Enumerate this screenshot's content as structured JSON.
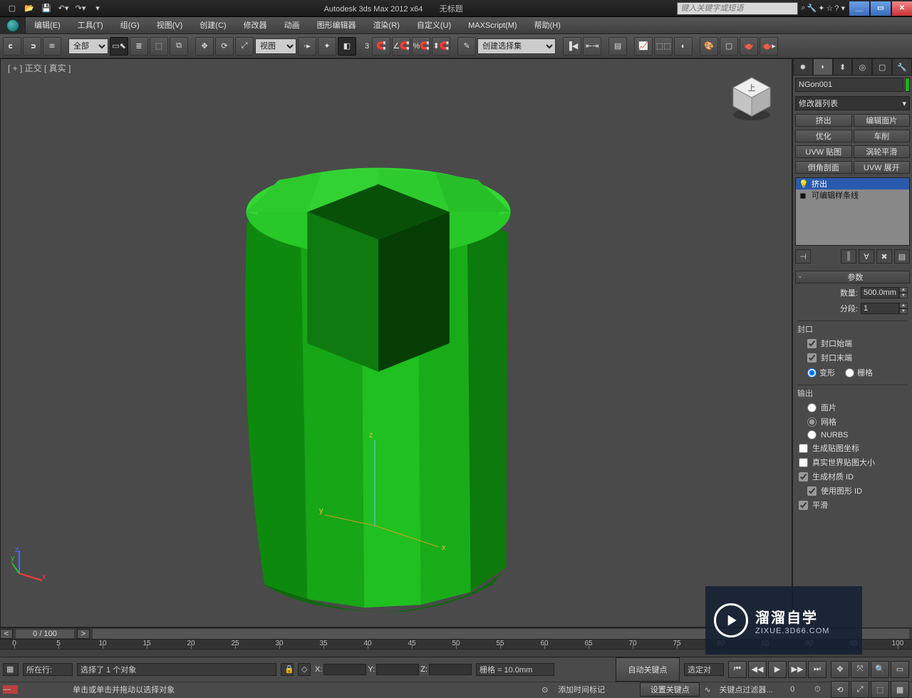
{
  "titlebar": {
    "app_title": "Autodesk 3ds Max  2012 x64",
    "doc_title": "无标题",
    "search_placeholder": "键入关键字或短语"
  },
  "menu": {
    "items": [
      "编辑(E)",
      "工具(T)",
      "组(G)",
      "视图(V)",
      "创建(C)",
      "修改器",
      "动画",
      "图形编辑器",
      "渲染(R)",
      "自定义(U)",
      "MAXScript(M)",
      "帮助(H)"
    ]
  },
  "toolbar": {
    "layer_sel": "全部",
    "view_sel": "视图",
    "named_sel": "创建选择集",
    "angle": "3"
  },
  "viewport": {
    "label": "[ + ] 正交 [ 真实  ]"
  },
  "panel": {
    "object_name": "NGon001",
    "mod_list_label": "修改器列表",
    "btn_rows": [
      [
        "挤出",
        "编辑面片"
      ],
      [
        "优化",
        "车削"
      ],
      [
        "UVW 贴图",
        "涡轮平滑"
      ],
      [
        "倒角剖面",
        "UVW 展开"
      ]
    ],
    "stack": [
      {
        "label": "挤出",
        "selected": true,
        "icon": "💡"
      },
      {
        "label": "可编辑样条线",
        "selected": false,
        "icon": "◼"
      }
    ],
    "rollout_params": "参数",
    "amount_label": "数量:",
    "amount_value": "500.0mm",
    "segs_label": "分段:",
    "segs_value": "1",
    "cap_group": "封口",
    "cap_start": "封口始端",
    "cap_end": "封口末端",
    "morph": "变形",
    "grid": "栅格",
    "output_group": "输出",
    "patch": "面片",
    "mesh": "网格",
    "nurbs": "NURBS",
    "gen_uv": "生成贴图坐标",
    "real_world": "真实世界贴图大小",
    "gen_matid": "生成材质 ID",
    "use_shapeid": "使用图形 ID",
    "smooth": "平滑"
  },
  "timeline": {
    "frame_label": "0 / 100",
    "ticks": [
      0,
      5,
      10,
      15,
      20,
      25,
      30,
      35,
      40,
      45,
      50,
      55,
      60,
      65,
      70,
      75,
      80,
      85,
      90,
      95,
      100
    ]
  },
  "status": {
    "sel_text": "选择了 1 个对象",
    "hint": "单击或单击并拖动以选择对象",
    "grid": "栅格 = 10.0mm",
    "add_time": "添加时间标记",
    "auto_key": "自动关键点",
    "set_key": "设置关键点",
    "sel_filter": "选定对",
    "key_filter": "关键点过滤器...",
    "script_label": "所在行:"
  },
  "watermark": {
    "cn": "溜溜自学",
    "en": "ZIXUE.3D66.COM"
  }
}
